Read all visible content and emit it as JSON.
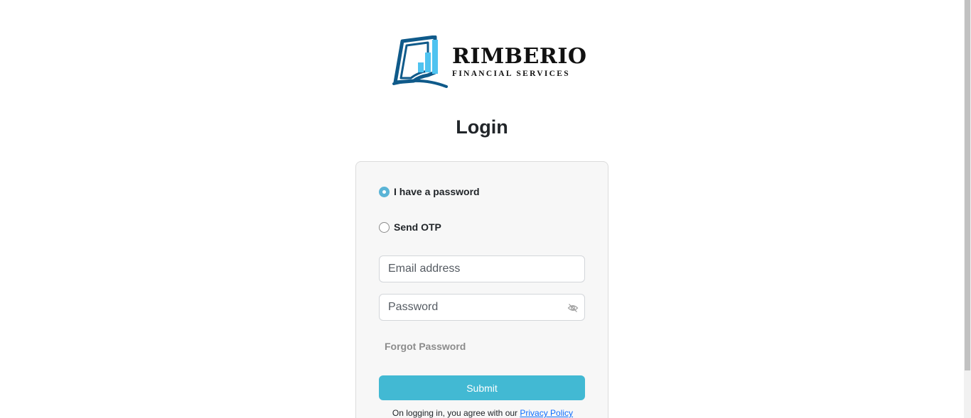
{
  "brand": {
    "name": "RIMBERIO",
    "tagline": "FINANCIAL SERVICES",
    "logo_icon": "book-bar-chart-logo",
    "colors": {
      "dark_blue": "#0f5a8a",
      "light_blue": "#4fc3f0"
    }
  },
  "login": {
    "title": "Login",
    "options": [
      {
        "label": "I have a password",
        "checked": true
      },
      {
        "label": "Send OTP",
        "checked": false
      }
    ],
    "email_placeholder": "Email address",
    "password_placeholder": "Password",
    "password_toggle_icon": "eye-slash-icon",
    "forgot_label": "Forgot Password",
    "submit_label": "Submit",
    "policy_text": "On logging in, you agree with our ",
    "policy_link": "Privacy Policy"
  },
  "colors": {
    "accent": "#42b9d3",
    "radio_selected": "#5ab4d6",
    "link": "#0d6efd",
    "card_bg": "#f7f7f7"
  }
}
